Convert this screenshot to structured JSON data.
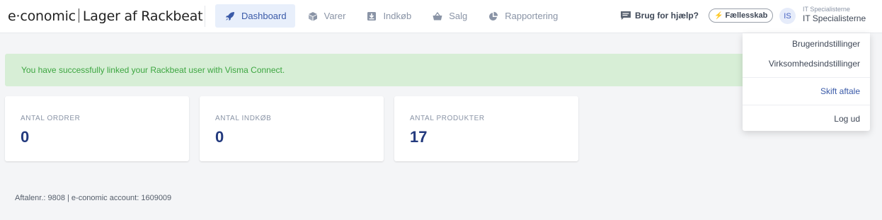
{
  "brand": {
    "company": "e·conomic",
    "app": "Lager af Rackbeat"
  },
  "nav": {
    "items": [
      {
        "label": "Dashboard",
        "icon": "rocket-icon",
        "active": true
      },
      {
        "label": "Varer",
        "icon": "cube-icon",
        "active": false
      },
      {
        "label": "Indkøb",
        "icon": "inbox-download-icon",
        "active": false
      },
      {
        "label": "Salg",
        "icon": "basket-icon",
        "active": false
      },
      {
        "label": "Rapportering",
        "icon": "pie-chart-icon",
        "active": false
      }
    ]
  },
  "header": {
    "help_label": "Brug for hjælp?",
    "community_label": "Fællesskab",
    "avatar_initials": "IS",
    "user_org": "IT Specialisterne",
    "user_name": "IT Specialisterne"
  },
  "alert": {
    "message": "You have successfully linked your Rackbeat user with Visma Connect."
  },
  "stats": [
    {
      "label": "ANTAL ORDRER",
      "value": "0"
    },
    {
      "label": "ANTAL INDKØB",
      "value": "0"
    },
    {
      "label": "ANTAL PRODUKTER",
      "value": "17"
    }
  ],
  "footer": {
    "text": "Aftalenr.: 9808 | e-conomic account: 1609009"
  },
  "user_menu": {
    "items": [
      {
        "label": "Brugerindstillinger"
      },
      {
        "label": "Virksomhedsindstillinger"
      },
      {
        "label": "Skift aftale"
      },
      {
        "label": "Log ud"
      }
    ]
  },
  "colors": {
    "accent": "#3a5aa8",
    "active_nav_bg": "#e8effb",
    "alert_bg": "#d7eed6",
    "alert_text": "#3da641",
    "stat_value": "#233a7e"
  }
}
